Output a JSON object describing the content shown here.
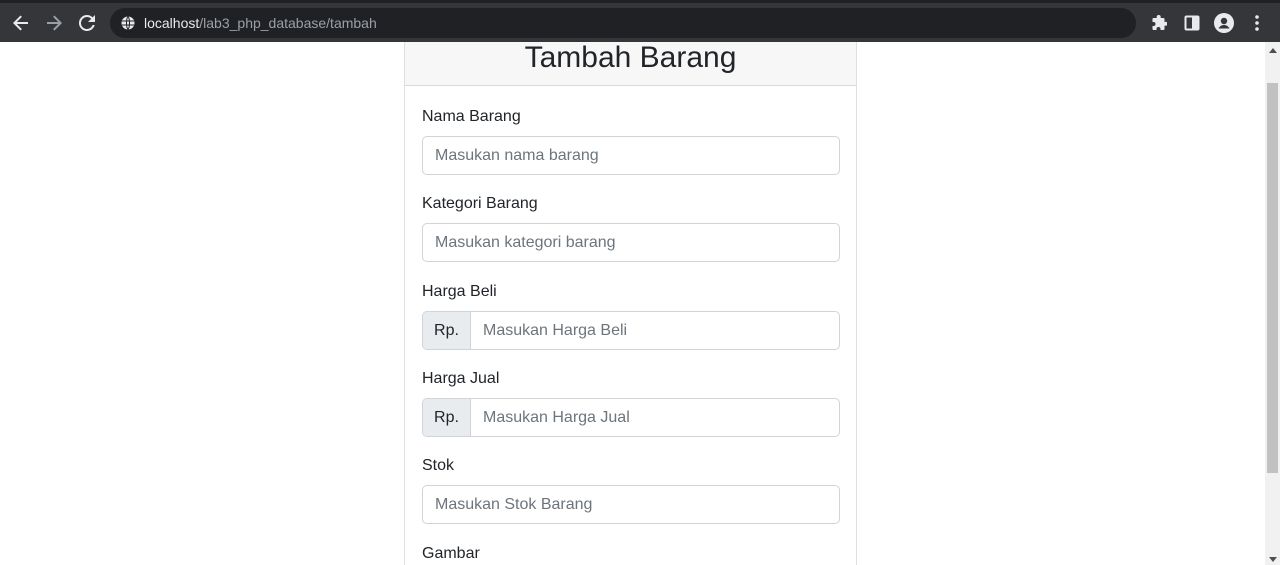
{
  "browser": {
    "url_host": "localhost",
    "url_path": "/lab3_php_database/tambah"
  },
  "page": {
    "title": "Tambah Barang"
  },
  "form": {
    "nama": {
      "label": "Nama Barang",
      "placeholder": "Masukan nama barang"
    },
    "kategori": {
      "label": "Kategori Barang",
      "placeholder": "Masukan kategori barang"
    },
    "harga_beli": {
      "label": "Harga Beli",
      "prefix": "Rp.",
      "placeholder": "Masukan Harga Beli"
    },
    "harga_jual": {
      "label": "Harga Jual",
      "prefix": "Rp.",
      "placeholder": "Masukan Harga Jual"
    },
    "stok": {
      "label": "Stok",
      "placeholder": "Masukan Stok Barang"
    },
    "gambar": {
      "label": "Gambar"
    }
  },
  "colors": {
    "chrome_bg": "#35363a",
    "omnibox_bg": "#202124",
    "card_header_bg": "#f7f7f7",
    "input_border": "#ced4da",
    "addon_bg": "#e9ecef"
  },
  "icons": [
    "back-arrow-icon",
    "forward-arrow-icon",
    "reload-icon",
    "site-info-icon",
    "extensions-icon",
    "side-panel-icon",
    "profile-icon",
    "menu-dots-icon"
  ]
}
